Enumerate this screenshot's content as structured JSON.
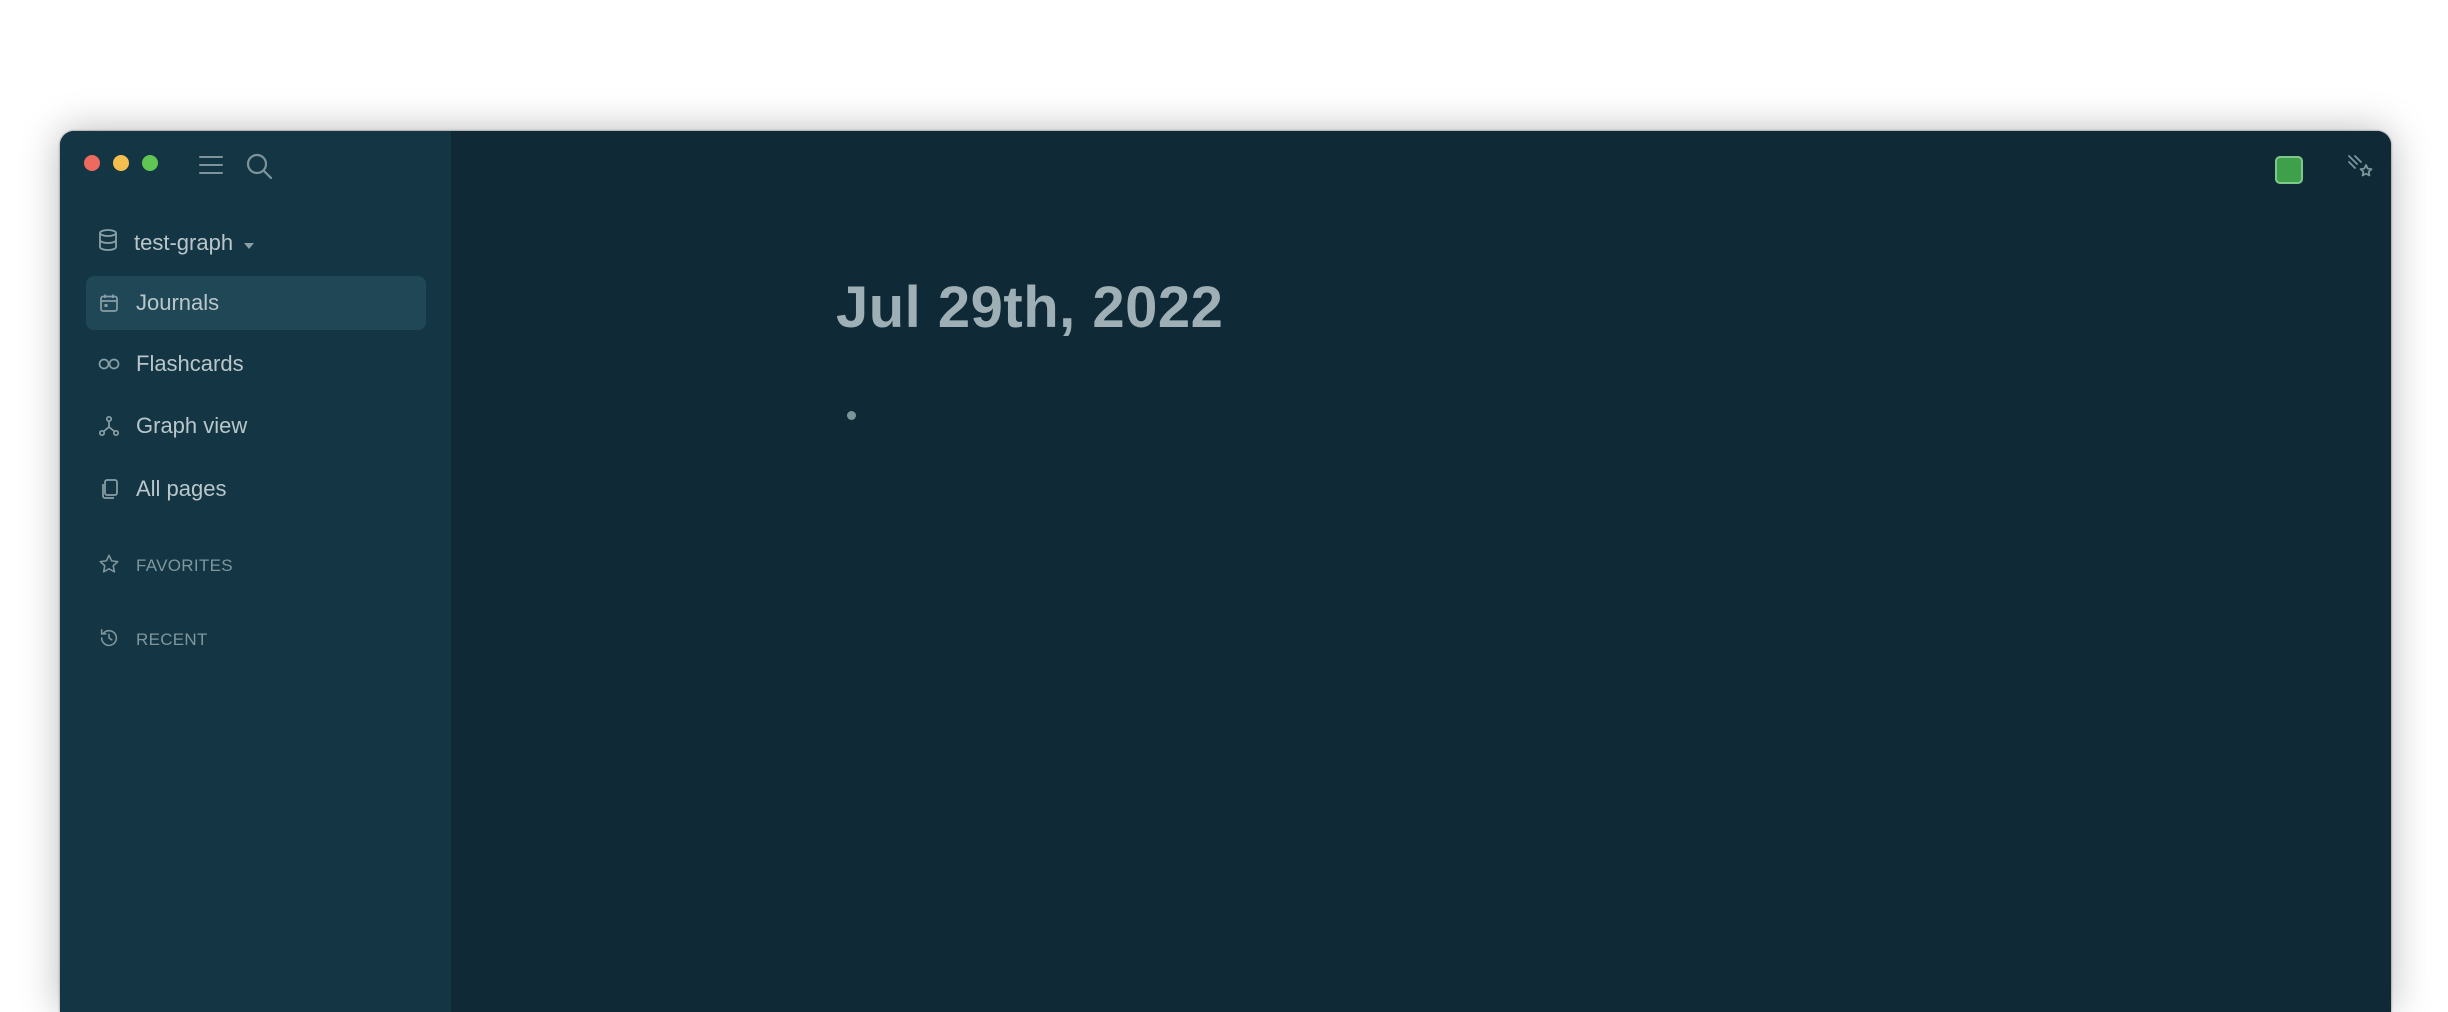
{
  "sidebar": {
    "repo_name": "test-graph",
    "nav_items": [
      {
        "label": "Journals",
        "icon": "calendar-icon",
        "active": true
      },
      {
        "label": "Flashcards",
        "icon": "infinity-icon",
        "active": false
      },
      {
        "label": "Graph view",
        "icon": "graph-icon",
        "active": false
      },
      {
        "label": "All pages",
        "icon": "pages-icon",
        "active": false
      }
    ],
    "favorites_label": "FAVORITES",
    "recent_label": "RECENT"
  },
  "toolbar": {
    "icons": [
      "menu-icon",
      "search-icon",
      "sync-status-icon",
      "shooting-star-icon",
      "calendar-icon",
      "hashtag-icon",
      "puzzle-icon",
      "arrow-left-icon",
      "arrow-right-icon",
      "more-icon",
      "right-sidebar-icon"
    ]
  },
  "journal": {
    "title": "Jul 29th, 2022"
  },
  "colors": {
    "sidebar_bg": "#143644",
    "main_bg": "#0f2a36",
    "active_nav_bg": "#1f4756",
    "sync_status": "#3fa04c"
  }
}
